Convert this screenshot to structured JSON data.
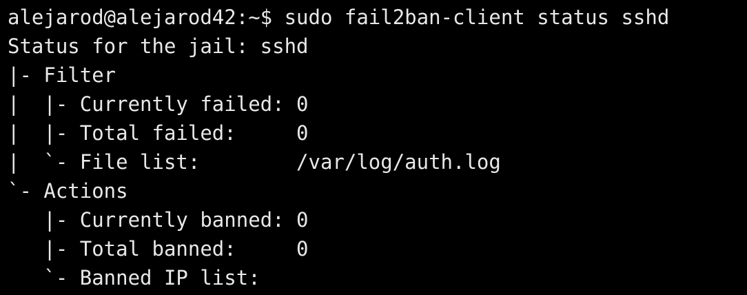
{
  "terminal": {
    "background": "#000000",
    "foreground": "#e8e8e8",
    "prompt": "alejarod@alejarod42:~$",
    "command": "sudo fail2ban-client status sshd",
    "lines": [
      "Status for the jail: sshd",
      "|- Filter",
      "|  |- Currently failed: 0",
      "|  |- Total failed:     0",
      "|  `- File list:        /var/log/auth.log",
      "`- Actions",
      "   |- Currently banned: 0",
      "   |- Total banned:     0",
      "   `- Banned IP list:"
    ]
  }
}
